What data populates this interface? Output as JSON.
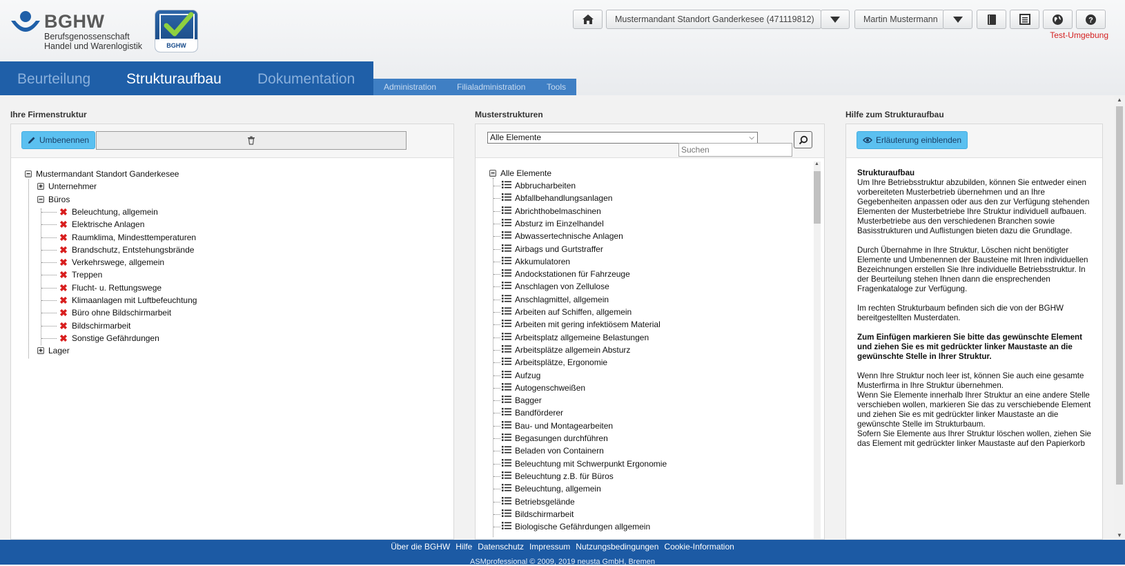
{
  "header": {
    "logo_brand": "BGHW",
    "logo_sub_line1": "Berufsgenossenschaft",
    "logo_sub_line2": "Handel und Warenlogistik",
    "badge_label": "BGHW",
    "company_selector": "Mustermandant Standort Ganderkesee (471119812)",
    "user_selector": "Martin Mustermann",
    "environment": "Test-Umgebung"
  },
  "main_tabs": [
    {
      "label": "Beurteilung"
    },
    {
      "label": "Strukturaufbau"
    },
    {
      "label": "Dokumentation"
    }
  ],
  "sub_tabs": [
    {
      "label": "Administration"
    },
    {
      "label": "Filialadministration"
    },
    {
      "label": "Tools"
    }
  ],
  "left": {
    "title": "Ihre Firmenstruktur",
    "rename_button": "Umbenennen",
    "tree": [
      {
        "label": "Mustermandant Standort Ganderkesee",
        "type": "root",
        "expander": "−"
      },
      {
        "label": "Unternehmer",
        "type": "group",
        "expander": "+"
      },
      {
        "label": "Büros",
        "type": "group",
        "expander": "−"
      },
      {
        "label": "Beleuchtung, allgemein",
        "type": "leaf"
      },
      {
        "label": "Elektrische Anlagen",
        "type": "leaf"
      },
      {
        "label": "Raumklima, Mindesttemperaturen",
        "type": "leaf"
      },
      {
        "label": "Brandschutz, Entstehungsbrände",
        "type": "leaf"
      },
      {
        "label": "Verkehrswege, allgemein",
        "type": "leaf"
      },
      {
        "label": "Treppen",
        "type": "leaf"
      },
      {
        "label": "Flucht- u. Rettungswege",
        "type": "leaf"
      },
      {
        "label": "Klimaanlagen mit Luftbefeuchtung",
        "type": "leaf"
      },
      {
        "label": "Büro ohne Bildschirmarbeit",
        "type": "leaf"
      },
      {
        "label": "Bildschirmarbeit",
        "type": "leaf"
      },
      {
        "label": "Sonstige Gefährdungen",
        "type": "leaf"
      },
      {
        "label": "Lager",
        "type": "group",
        "expander": "+"
      }
    ]
  },
  "middle": {
    "title": "Musterstrukturen",
    "filter_value": "Alle Elemente",
    "search_placeholder": "Suchen",
    "root_label": "Alle Elemente",
    "root_expander": "−",
    "items": [
      "Abbrucharbeiten",
      "Abfallbehandlungsanlagen",
      "Abrichthobelmaschinen",
      "Absturz im Einzelhandel",
      "Abwassertechnische Anlagen",
      "Airbags und Gurtstraffer",
      "Akkumulatoren",
      "Andockstationen für Fahrzeuge",
      "Anschlagen von Zellulose",
      "Anschlagmittel, allgemein",
      "Arbeiten auf Schiffen, allgemein",
      "Arbeiten mit gering infektiösem Material",
      "Arbeitsplatz allgemeine Belastungen",
      "Arbeitsplätze allgemein Absturz",
      "Arbeitsplätze, Ergonomie",
      "Aufzug",
      "Autogenschweißen",
      "Bagger",
      "Bandförderer",
      "Bau- und Montagearbeiten",
      "Begasungen durchführen",
      "Beladen von Containern",
      "Beleuchtung mit Schwerpunkt Ergonomie",
      "Beleuchtung z.B. für Büros",
      "Beleuchtung, allgemein",
      "Betriebsgelände",
      "Bildschirmarbeit",
      "Biologische Gefährdungen allgemein"
    ]
  },
  "right": {
    "title": "Hilfe zum Strukturaufbau",
    "explain_button": "Erläuterung einblenden",
    "help_heading": "Strukturaufbau",
    "help_p1": "Um Ihre Betriebsstruktur abzubilden, können Sie entweder einen vorbereiteten Musterbetrieb übernehmen und an Ihre Gegebenheiten anpassen oder aus den zur Verfügung stehenden Elementen der Musterbetriebe Ihre Struktur individuell aufbauen.",
    "help_p1b": "Musterbetriebe aus den verschiedenen Branchen sowie Basisstrukturen und Auflistungen bieten dazu die Grundlage.",
    "help_p2": "Durch Übernahme in Ihre Struktur, Löschen nicht benötigter Elemente und Umbenennen der Bausteine mit Ihren individuellen Bezeichnungen erstellen Sie Ihre individuelle Betriebsstruktur. In der Beurteilung stehen Ihnen dann die ensprechenden Fragenkataloge zur Verfügung.",
    "help_p3": "Im rechten Strukturbaum befinden sich die von der BGHW bereitgestellten Musterdaten.",
    "help_p4": "Zum Einfügen markieren Sie bitte das gewünschte Element und ziehen Sie es mit gedrückter linker Maustaste an die gewünschte Stelle in Ihrer Struktur.",
    "help_p5a": "Wenn Ihre Struktur noch leer ist, können Sie auch eine gesamte Musterfirma in Ihre Struktur übernehmen.",
    "help_p5b": "Wenn Sie Elemente innerhalb Ihrer Struktur an eine andere Stelle verschieben wollen, markieren Sie das zu verschiebende Element und ziehen Sie es mit gedrückter linker Maustaste an die gewünschte Stelle im Strukturbaum.",
    "help_p5c": "Sofern Sie Elemente aus Ihrer Struktur löschen wollen, ziehen Sie das Element mit gedrückter linker Maustaste auf den Papierkorb"
  },
  "footer": {
    "links": [
      "Über die BGHW",
      "Hilfe",
      "Datenschutz",
      "Impressum",
      "Nutzungsbedingungen",
      "Cookie-Information"
    ],
    "copyright": "ASMprofessional © 2009, 2019 neusta GmbH, Bremen"
  }
}
